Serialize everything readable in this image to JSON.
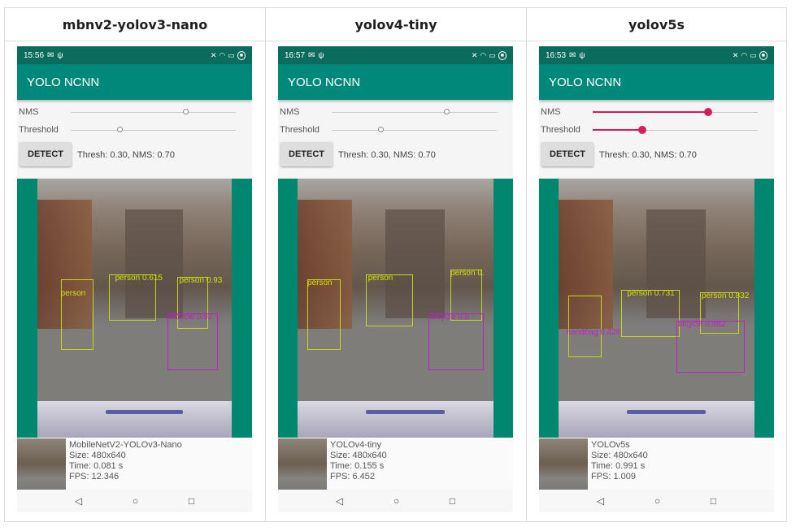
{
  "columns": [
    {
      "header": "mbnv2-yolov3-nano",
      "time": "15:56",
      "app_title": "YOLO NCNN",
      "nms_label": "NMS",
      "threshold_label": "Threshold",
      "nms_value": 0.7,
      "threshold_value": 0.3,
      "slider_active": false,
      "detect_label": "DETECT",
      "status_line": "Thresh: 0.30, NMS: 0.70",
      "model_name": "MobileNetV2-YOLOv3-Nano",
      "size": "Size: 480x640",
      "time_taken": "Time: 0.081 s",
      "fps": "FPS: 12.346",
      "labels": [
        "person 0.615",
        "person 0.93",
        "bicycle 0.92",
        "person"
      ]
    },
    {
      "header": "yolov4-tiny",
      "time": "16:57",
      "app_title": "YOLO NCNN",
      "nms_label": "NMS",
      "threshold_label": "Threshold",
      "nms_value": 0.7,
      "threshold_value": 0.3,
      "slider_active": false,
      "detect_label": "DETECT",
      "status_line": "Thresh: 0.30, NMS: 0.70",
      "model_name": "YOLOv4-tiny",
      "size": "Size: 480x640",
      "time_taken": "Time: 0.155 s",
      "fps": "FPS: 6.452",
      "labels": [
        "person",
        "person 0.",
        "bicycle 0.9",
        "person"
      ]
    },
    {
      "header": "yolov5s",
      "time": "16:53",
      "app_title": "YOLO NCNN",
      "nms_label": "NMS",
      "threshold_label": "Threshold",
      "nms_value": 0.7,
      "threshold_value": 0.3,
      "slider_active": true,
      "detect_label": "DETECT",
      "status_line": "Thresh: 0.30, NMS: 0.70",
      "model_name": "YOLOv5s",
      "size": "Size: 480x640",
      "time_taken": "Time: 0.991 s",
      "fps": "FPS: 1.009",
      "labels": [
        "person 0.832",
        "handbag 0.426",
        "bicycle 0.882",
        "person 0.731"
      ]
    }
  ],
  "nav": {
    "back": "◁",
    "home": "○",
    "recents": "□"
  },
  "colors": {
    "appbar": "#00887a",
    "statusbar": "#0b6b5c",
    "accent": "#d81b60",
    "box_yellow": "#c7d51a",
    "box_magenta": "#c21fc6"
  }
}
